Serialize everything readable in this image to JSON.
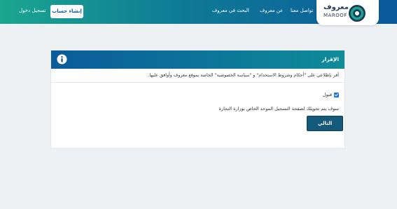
{
  "header": {
    "logo_ar": "معروف",
    "logo_en": "MAROOF",
    "nav": [
      "تواصل معنا",
      "عن معروف",
      "البحث في معروف"
    ],
    "signup_label": "إنشاء حساب",
    "login_label": "تسجيل دخول"
  },
  "card": {
    "title": "الإقرار",
    "acknowledgement": "أقر بإطلاعي على \"أحكام وشروط الاستخدام\" و \"سياسة الخصوصية\" الخاصة بموقع معروف وأوافق عليها.",
    "accept_label": "قبول",
    "accept_checked": true,
    "redirect_note": "سوف يتم تحويلك لصفحة التسجيل الموحد الخاص بوزارة التجارة",
    "next_label": "التالي"
  },
  "colors": {
    "header_gradient_start": "#1aa68f",
    "header_gradient_end": "#0b5b9a",
    "next_button": "#15597a"
  }
}
